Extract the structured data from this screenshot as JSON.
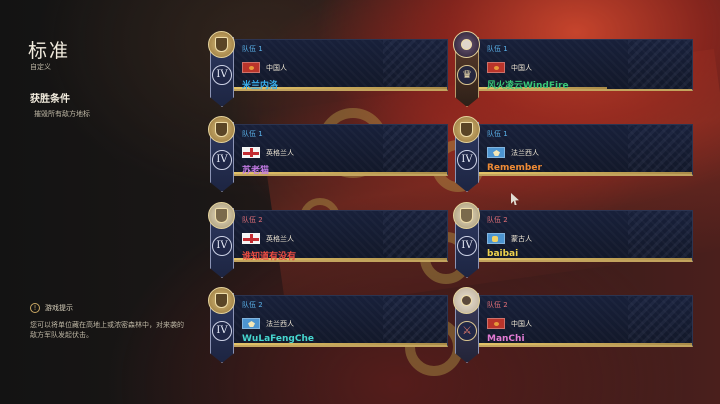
{
  "mode": {
    "title": "标准",
    "subtitle": "自定义"
  },
  "victory": {
    "title": "获胜条件",
    "description": "摧毁所有敌方地标"
  },
  "tip": {
    "icon": "info-icon",
    "label": "游戏提示",
    "text": "您可以将单位藏在高地上或浓密森林中，对来袭的敌方军队发起伏击。"
  },
  "colors": {
    "team1_label": "#59b0e8",
    "team2_label": "#e26f76",
    "player_blue": "#39aeea",
    "player_green": "#39c878",
    "player_purple": "#c17ae3",
    "player_orange": "#ef8b35",
    "player_red": "#ec4c42",
    "player_yellow": "#efd34d",
    "player_teal": "#46d6cf",
    "player_pink": "#e37bd4"
  },
  "players": {
    "p1": {
      "team": "队伍 1",
      "civ": "中国人",
      "flag": "china-flag-icon",
      "name": "米兰内洛",
      "age": "IV"
    },
    "p2": {
      "team": "队伍 1",
      "civ": "中国人",
      "flag": "china-flag-icon",
      "name": "风火凌云WindFire",
      "age": ""
    },
    "p3": {
      "team": "队伍 1",
      "civ": "英格兰人",
      "flag": "england-flag-icon",
      "name": "苏老猫",
      "age": "IV"
    },
    "p4": {
      "team": "队伍 1",
      "civ": "法兰西人",
      "flag": "france-flag-icon",
      "name": "Remember",
      "age": "IV"
    },
    "p5": {
      "team": "队伍 2",
      "civ": "英格兰人",
      "flag": "england-flag-icon",
      "name": "谁知道有没有",
      "age": "IV"
    },
    "p6": {
      "team": "队伍 2",
      "civ": "蒙古人",
      "flag": "mongol-flag-icon",
      "name": "baibai",
      "age": "IV"
    },
    "p7": {
      "team": "队伍 2",
      "civ": "法兰西人",
      "flag": "france-flag-icon",
      "name": "WuLaFengChe",
      "age": "IV"
    },
    "p8": {
      "team": "队伍 2",
      "civ": "中国人",
      "flag": "china-flag-icon",
      "name": "ManChi",
      "age": ""
    }
  }
}
